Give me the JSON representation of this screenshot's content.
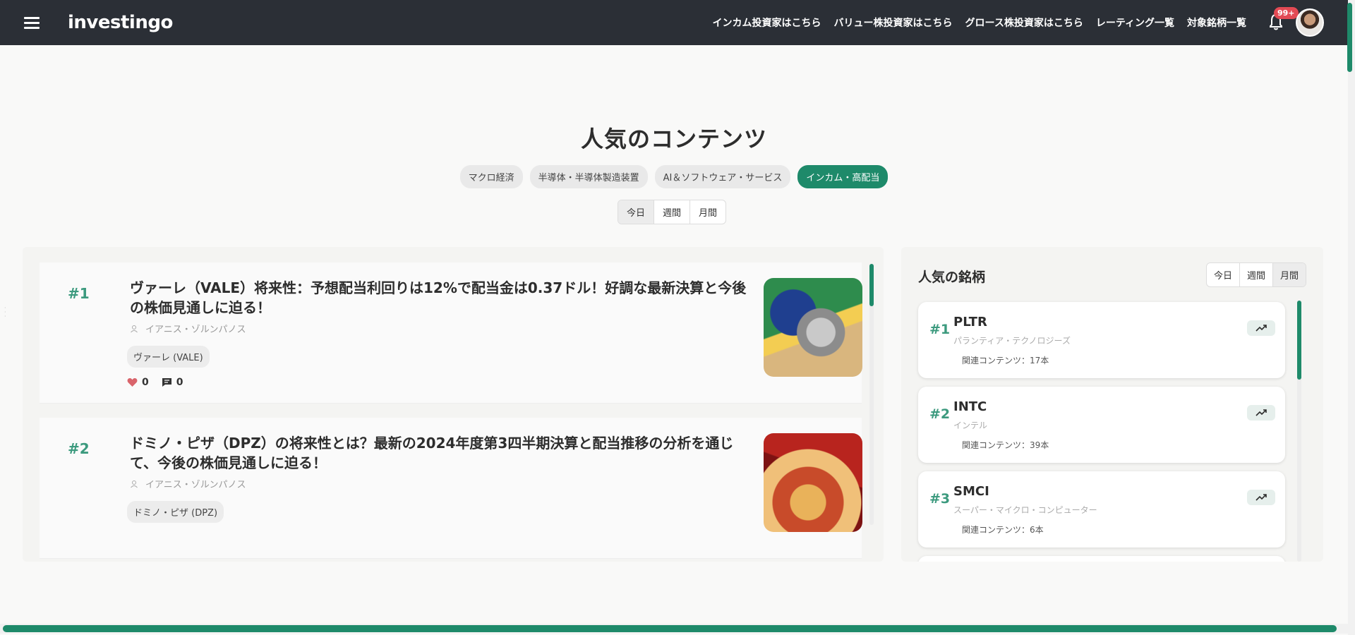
{
  "header": {
    "logo": "investingo",
    "nav": [
      "インカム投資家はこちら",
      "バリュー株投資家はこちら",
      "グロース株投資家はこちら",
      "レーティング一覧",
      "対象銘柄一覧"
    ],
    "notification_count": "99+"
  },
  "main": {
    "title": "人気のコンテンツ",
    "categories": [
      "マクロ経済",
      "半導体・半導体製造装置",
      "AI＆ソフトウェア・サービス",
      "インカム・高配当"
    ],
    "active_category": "インカム・高配当",
    "periods": [
      "今日",
      "週間",
      "月間"
    ],
    "active_period": "今日"
  },
  "articles": [
    {
      "rank": "#1",
      "title": "ヴァーレ（VALE）将来性：予想配当利回りは12%で配当金は0.37ドル！好調な最新決算と今後の株価見通しに迫る！",
      "author": "イアニス・ゾルンパノス",
      "tag": "ヴァーレ (VALE)",
      "likes": "0",
      "comments": "0",
      "image": "bitcoin-image"
    },
    {
      "rank": "#2",
      "title": "ドミノ・ピザ（DPZ）の将来性とは？最新の2024年度第3四半期決算と配当推移の分析を通じて、今後の株価見通しに迫る！",
      "author": "イアニス・ゾルンパノス",
      "tag": "ドミノ・ピザ (DPZ)",
      "image": "pizza-image"
    }
  ],
  "stocks_panel": {
    "title": "人気の銘柄",
    "periods": [
      "今日",
      "週間",
      "月間"
    ],
    "active_period": "月間",
    "items": [
      {
        "rank": "#1",
        "ticker": "PLTR",
        "name": "パランティア・テクノロジーズ",
        "related": "関連コンテンツ：17本"
      },
      {
        "rank": "#2",
        "ticker": "INTC",
        "name": "インテル",
        "related": "関連コンテンツ：39本"
      },
      {
        "rank": "#3",
        "ticker": "SMCI",
        "name": "スーパー・マイクロ・コンピューター",
        "related": "関連コンテンツ：6本"
      }
    ]
  },
  "colors": {
    "accent": "#1e8a6a",
    "rank": "#3c9a7e",
    "topbar": "#2b2f36",
    "badge": "#e24a54"
  }
}
